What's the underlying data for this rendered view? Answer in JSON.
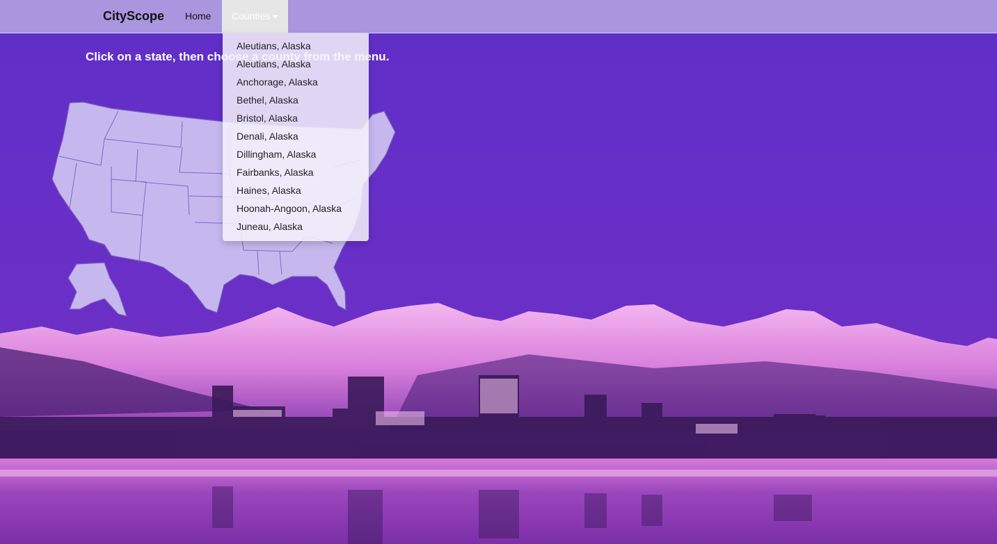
{
  "navbar": {
    "brand": "CityScope",
    "home": "Home",
    "counties": "Counties"
  },
  "instruction": "Click on a state, then choose a county from the menu.",
  "dropdown": {
    "items": [
      "Aleutians, Alaska",
      "Aleutians, Alaska",
      "Anchorage, Alaska",
      "Bethel, Alaska",
      "Bristol, Alaska",
      "Denali, Alaska",
      "Dillingham, Alaska",
      "Fairbanks, Alaska",
      "Haines, Alaska",
      "Hoonah-Angoon, Alaska",
      "Juneau, Alaska"
    ]
  },
  "colors": {
    "navbar": "#a996df",
    "sky_top": "#5a2cc4",
    "map_fill": "#c6b8ee",
    "mountains": "#e79ae8",
    "active_tab": "#e6e6e6"
  }
}
